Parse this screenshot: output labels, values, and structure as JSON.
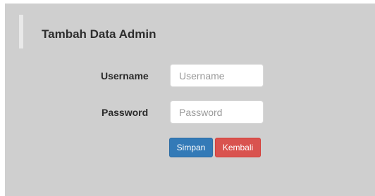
{
  "form": {
    "title": "Tambah Data Admin",
    "username_label": "Username",
    "username_placeholder": "Username",
    "username_value": "",
    "password_label": "Password",
    "password_placeholder": "Password",
    "password_value": "",
    "save_label": "Simpan",
    "back_label": "Kembali"
  },
  "colors": {
    "panel_bg": "#cfcfcf",
    "save_button": "#337ab7",
    "back_button": "#d9534f"
  }
}
